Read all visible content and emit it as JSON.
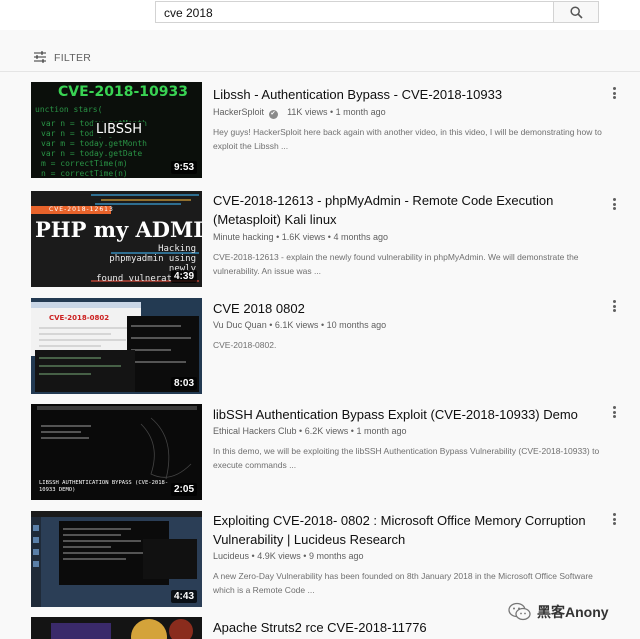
{
  "search": {
    "query": "cve 2018",
    "search_icon": "search-icon"
  },
  "filter": {
    "label": "FILTER",
    "icon": "filter-icon"
  },
  "results": [
    {
      "thumb_title": "CVE-2018-10933",
      "thumb_sub": "LIBSSH",
      "duration": "9:53",
      "title": "Libssh - Authentication Bypass - CVE-2018-10933",
      "channel": "HackerSploit",
      "verified": "✔",
      "views": "11K views",
      "age": "1 month ago",
      "description": "Hey guys! HackerSploit here back again with another video, in this video, I will be demonstrating how to exploit the Libssh ..."
    },
    {
      "thumb_banner": "CVE-2018-12613",
      "thumb_title": "PHP my ADMIN",
      "thumb_lines": [
        "Hacking",
        "phpmyadmin using",
        "newly",
        "found vulnerat"
      ],
      "duration": "4:39",
      "title": "CVE-2018-12613 - phpMyAdmin - Remote Code Execution (Metasploit) Kali linux",
      "channel": "Minute hacking",
      "views": "1.6K views",
      "age": "4 months ago",
      "description": "CVE-2018-12613 - explain the newly found vulnerability in phpMyAdmin. We will demonstrate the vulnerability. An issue was ..."
    },
    {
      "thumb_title": "CVE-2018-0802",
      "duration": "8:03",
      "title": "CVE 2018 0802",
      "channel": "Vu Duc Quan",
      "views": "6.1K views",
      "age": "10 months ago",
      "description": "CVE-2018-0802."
    },
    {
      "thumb_caption": "LIBSSH AUTHENTICATION BYPASS (CVE-2018-10933 DEMO)",
      "duration": "2:05",
      "title": "libSSH Authentication Bypass Exploit (CVE-2018-10933) Demo",
      "channel": "Ethical Hackers Club",
      "views": "6.2K views",
      "age": "1 month ago",
      "description": "In this demo, we will be exploiting the libSSH Authentication Bypass Vulnerability (CVE-2018-10933) to execute commands ..."
    },
    {
      "duration": "4:43",
      "title": "Exploiting CVE-2018- 0802 : Microsoft Office Memory Corruption Vulnerability | Lucideus Research",
      "channel": "Lucideus",
      "views": "4.9K views",
      "age": "9 months ago",
      "description": "A new Zero-Day Vulnerability has been founded on 8th January 2018 in the Microsoft Office Software which is a Remote Code ..."
    },
    {
      "title": "Apache Struts2 rce CVE-2018-11776"
    }
  ],
  "watermark": {
    "text": "黑客Anony",
    "icon": "wechat-icon"
  },
  "colors": {
    "background": "#f9f9f9",
    "title": "#0f0f0f",
    "meta": "#606060",
    "thumb_green": "#39d353"
  }
}
